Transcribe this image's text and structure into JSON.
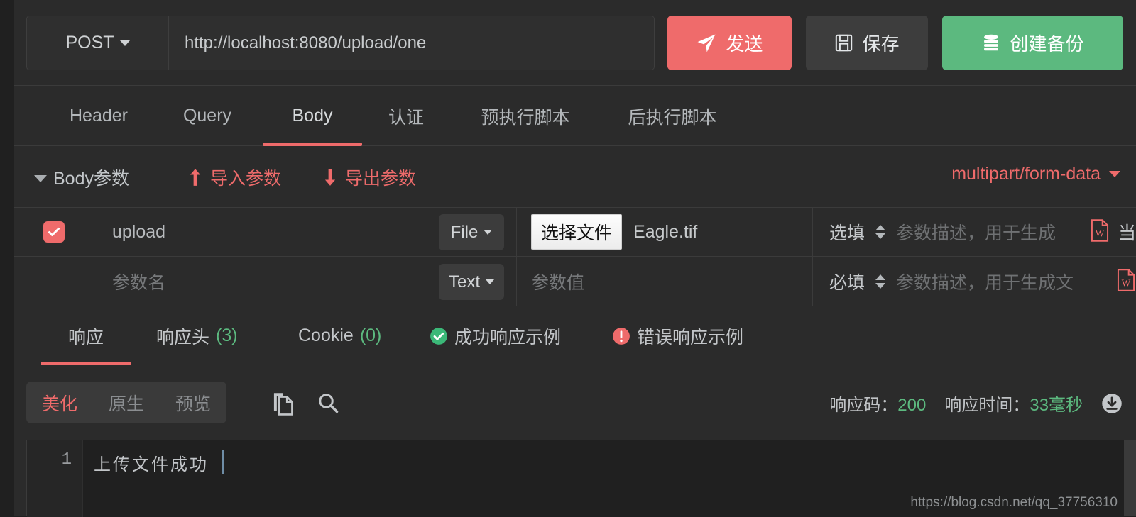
{
  "request": {
    "method": "POST",
    "method_icon": "chevron-down-icon",
    "url": "http://localhost:8080/upload/one",
    "url_placeholder": "http://localhost:8080/upload/one",
    "send_label": "发送",
    "send_icon": "paper-plane-icon",
    "save_label": "保存",
    "save_icon": "floppy-disk-icon",
    "backup_label": "创建备份",
    "backup_icon": "database-icon"
  },
  "request_tabs": [
    {
      "label": "Header",
      "active": false
    },
    {
      "label": "Query",
      "active": false
    },
    {
      "label": "Body",
      "active": true
    },
    {
      "label": "认证",
      "active": false
    },
    {
      "label": "预执行脚本",
      "active": false
    },
    {
      "label": "后执行脚本",
      "active": false
    }
  ],
  "body_header": {
    "collapse_icon": "triangle-down-icon",
    "title": "Body参数",
    "import_label": "导入参数",
    "import_icon": "arrow-up-icon",
    "export_label": "导出参数",
    "export_icon": "arrow-down-icon",
    "content_type": "multipart/form-data",
    "content_type_icon": "chevron-down-icon"
  },
  "param_columns": {
    "name_placeholder": "参数名",
    "value_placeholder": "参数值",
    "desc_placeholder": "参数描述，用于生成文档"
  },
  "param_rows": [
    {
      "checked": true,
      "name": "upload",
      "name_is_placeholder": false,
      "type": "File",
      "value_kind": "file",
      "file_button_label": "选择文件",
      "file_name": "Eagle.tif",
      "required_label": "选填",
      "desc_placeholder": "参数描述，用于生成文档",
      "desc_clipped": "参数描述，用于生成",
      "word_icon": "word-doc-icon",
      "trailing_text": "当"
    },
    {
      "checked": false,
      "name": "参数名",
      "name_is_placeholder": true,
      "type": "Text",
      "value_kind": "text",
      "value_placeholder": "参数值",
      "required_label": "必填",
      "desc_placeholder": "参数描述，用于生成文档",
      "desc_clipped": "参数描述，用于生成文",
      "word_icon": "word-doc-icon",
      "trailing_text": ""
    }
  ],
  "response_tabs": [
    {
      "label": "响应",
      "count": "",
      "icon": "",
      "active": true
    },
    {
      "label": "响应头",
      "count": "(3)",
      "icon": "",
      "active": false
    },
    {
      "label": "Cookie",
      "count": "(0)",
      "icon": "",
      "active": false
    },
    {
      "label": "成功响应示例",
      "count": "",
      "icon": "check-circle-icon",
      "active": false
    },
    {
      "label": "错误响应示例",
      "count": "",
      "icon": "error-circle-icon",
      "active": false
    }
  ],
  "response_toolbar": {
    "view_modes": [
      {
        "label": "美化",
        "active": true
      },
      {
        "label": "原生",
        "active": false
      },
      {
        "label": "预览",
        "active": false
      }
    ],
    "copy_icon": "copy-icon",
    "search_icon": "search-icon",
    "status_code_label": "响应码：",
    "status_code_value": "200",
    "time_label": "响应时间：",
    "time_value": "33毫秒",
    "download_icon": "download-circle-icon"
  },
  "editor": {
    "line_number": "1",
    "line_text": "上传文件成功"
  },
  "watermark": "https://blog.csdn.net/qq_37756310",
  "colors": {
    "accent_red": "#ef6b6b",
    "accent_green": "#5cb97f",
    "bg": "#2b2b2b",
    "bg_dark": "#202020",
    "text": "#c3c7ca",
    "text_muted": "#77797b"
  }
}
